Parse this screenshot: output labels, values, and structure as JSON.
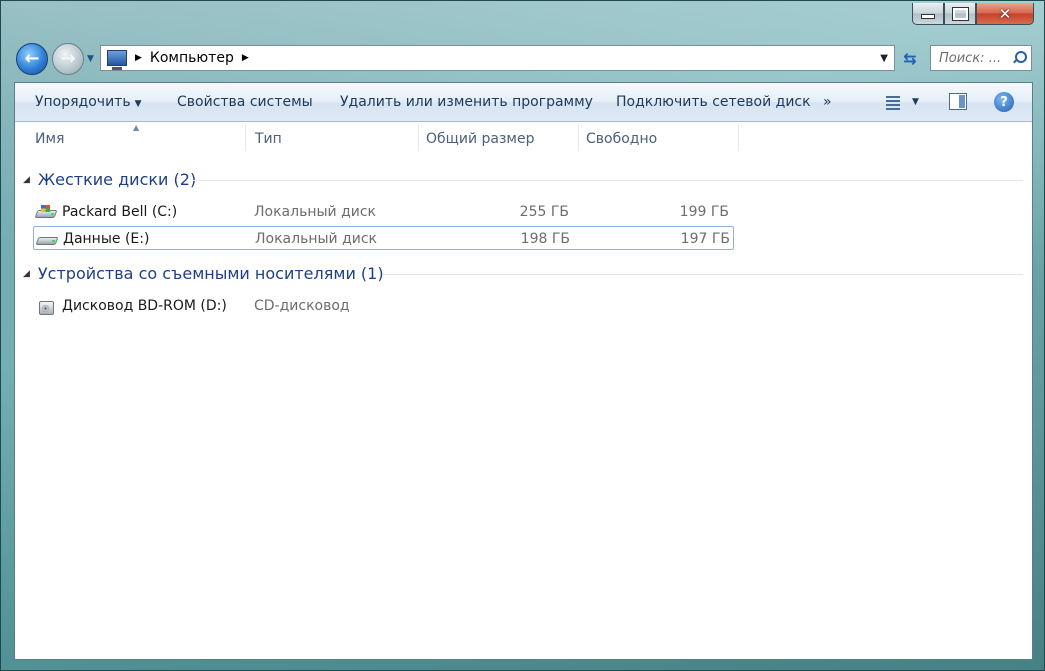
{
  "window": {
    "caption_buttons": {
      "minimize": "minimize",
      "maximize": "maximize",
      "close": "✕"
    }
  },
  "navigation": {
    "back_icon": "arrow-left-icon",
    "forward_icon": "arrow-right-icon",
    "breadcrumb": [
      "Компьютер"
    ],
    "search_placeholder": "Поиск: ..."
  },
  "toolbar": {
    "organize": "Упорядочить",
    "system_properties": "Свойства системы",
    "uninstall": "Удалить или изменить программу",
    "map_drive": "Подключить сетевой диск",
    "more": "»",
    "help": "?"
  },
  "columns": {
    "name": "Имя",
    "type": "Тип",
    "total_size": "Общий размер",
    "free": "Свободно"
  },
  "groups": [
    {
      "title": "Жесткие диски (2)",
      "items": [
        {
          "name": "Packard Bell (C:)",
          "type": "Локальный диск",
          "total_size": "255 ГБ",
          "free": "199 ГБ",
          "icon": "windows-drive-icon"
        },
        {
          "name": "Данные (E:)",
          "type": "Локальный диск",
          "total_size": "198 ГБ",
          "free": "197 ГБ",
          "icon": "hard-drive-icon"
        }
      ]
    },
    {
      "title": "Устройства со съемными носителями (1)",
      "items": [
        {
          "name": "Дисковод BD-ROM (D:)",
          "type": "CD-дисковод",
          "icon": "optical-drive-icon"
        }
      ]
    }
  ],
  "colors": {
    "accent": "#1e3f8a",
    "selection_border": "#8fb3d8"
  }
}
